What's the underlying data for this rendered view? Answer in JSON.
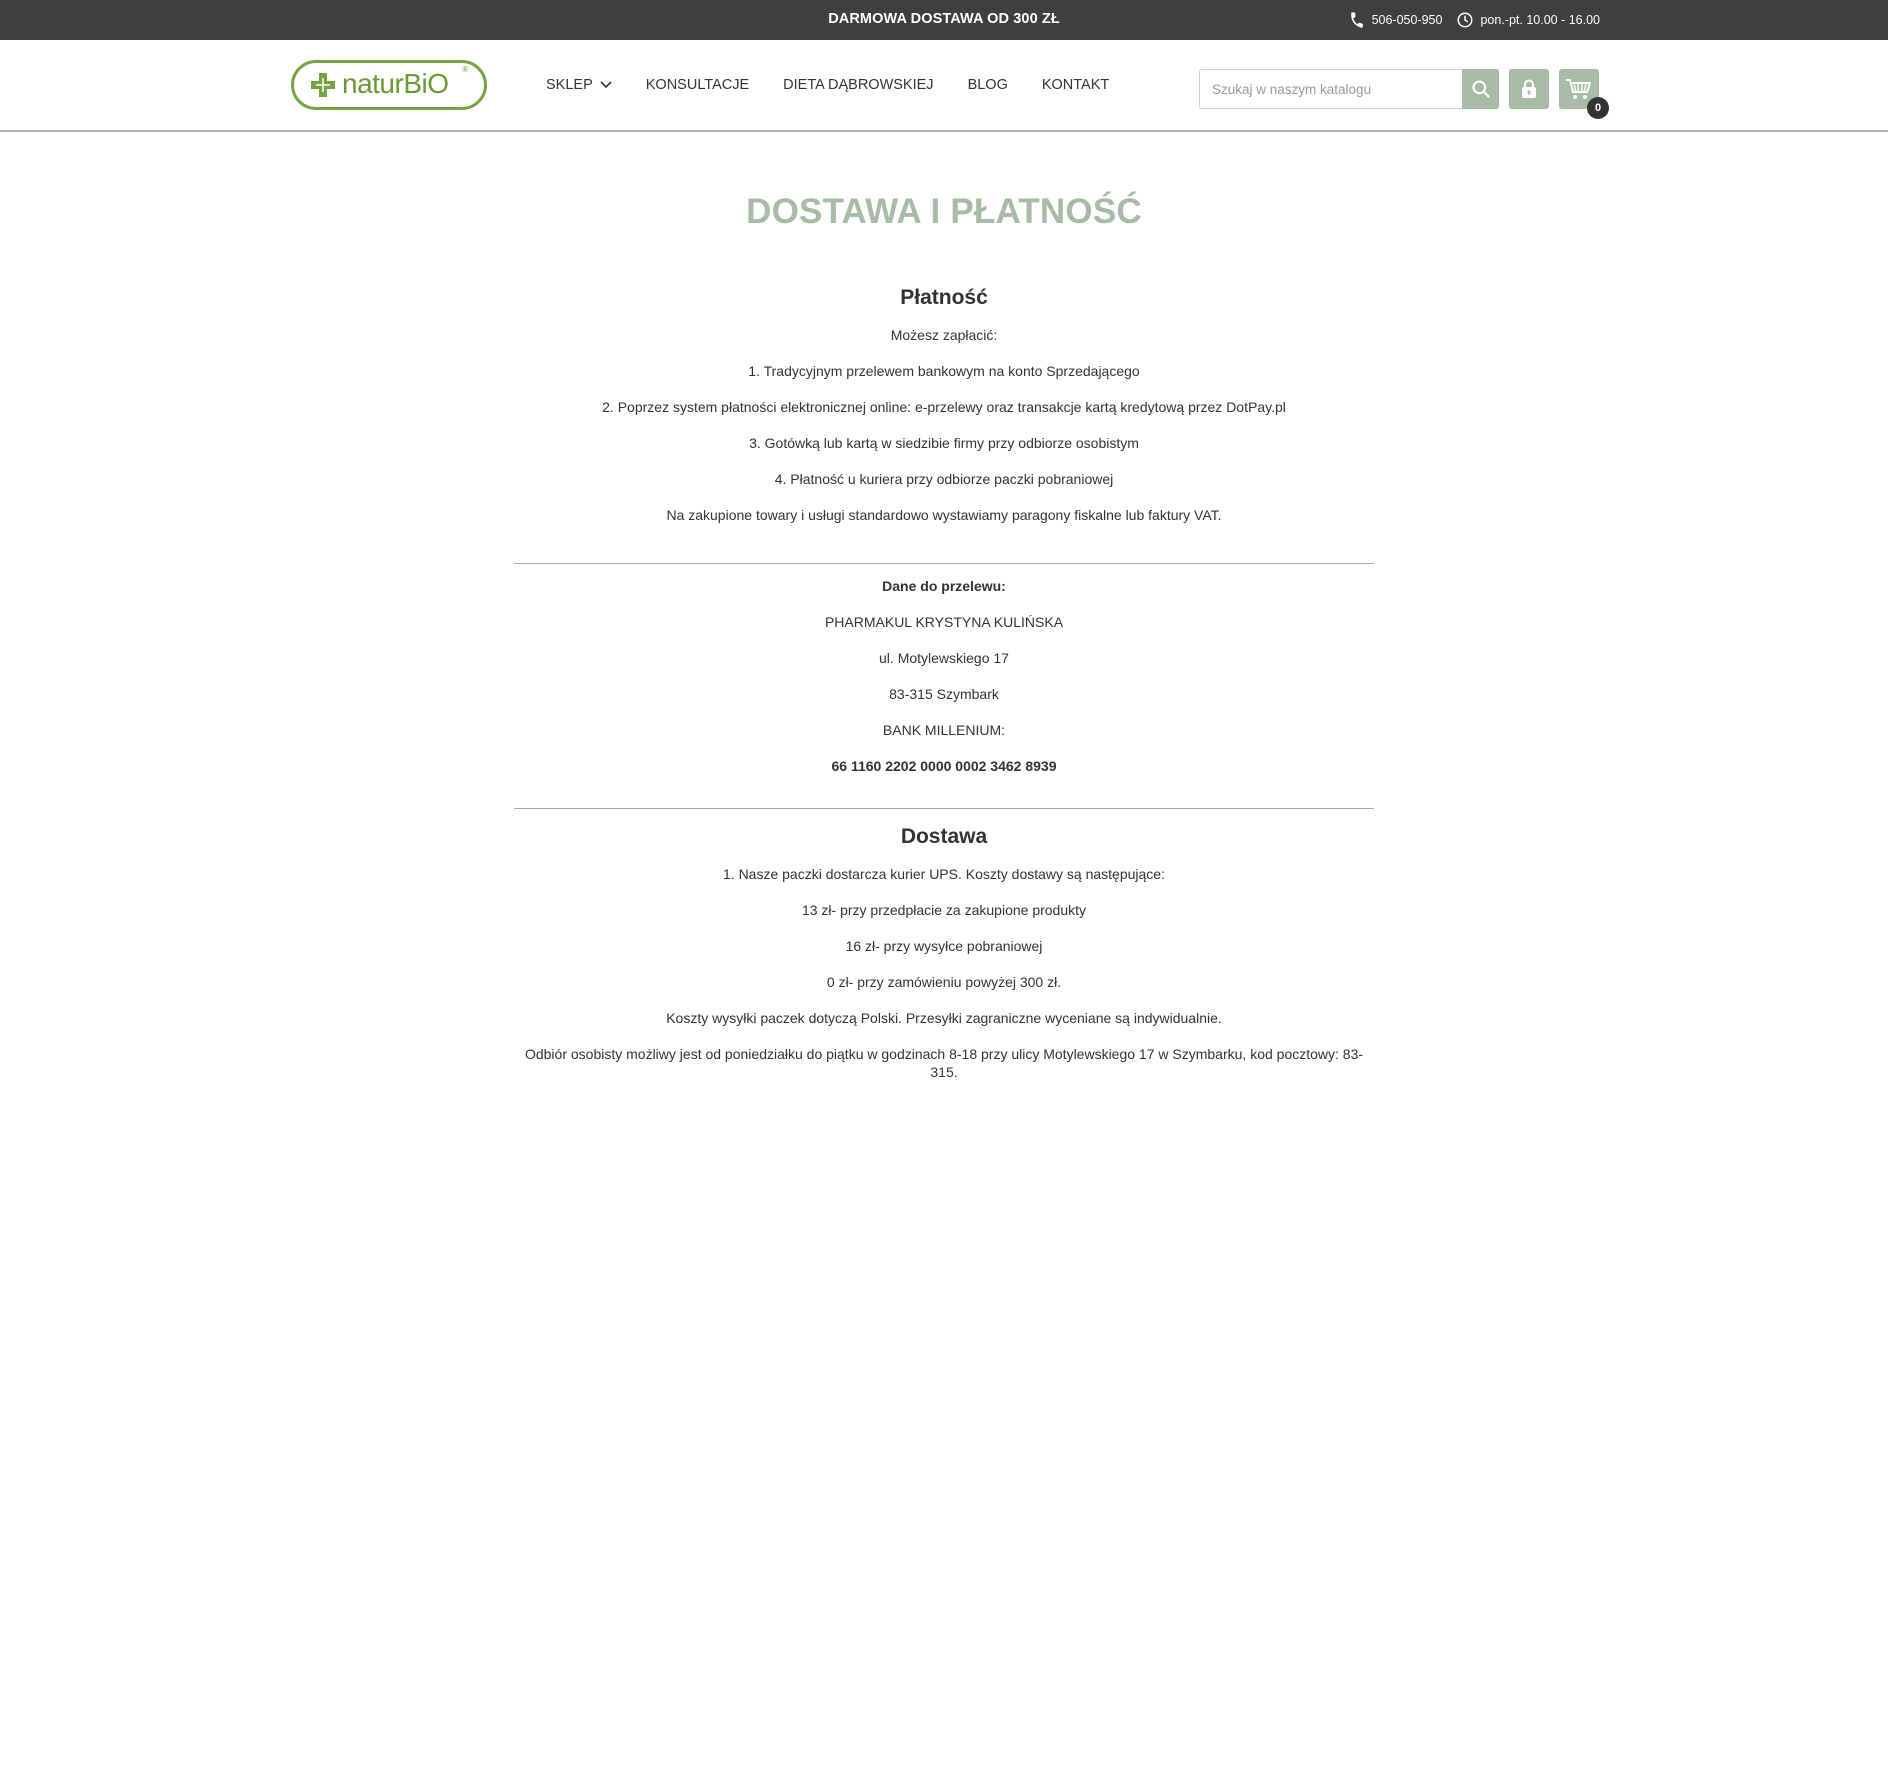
{
  "topbar": {
    "promo": "DARMOWA DOSTAWA OD 300 ZŁ",
    "phone": "506-050-950",
    "hours": "pon.-pt. 10.00 - 16.00",
    "phone_icon": "phone-icon",
    "clock_icon": "clock-icon"
  },
  "header": {
    "logo_text": "naturBiO",
    "logo_reg": "®",
    "nav": [
      {
        "label": "SKLEP",
        "has_dropdown": true
      },
      {
        "label": "KONSULTACJE"
      },
      {
        "label": "DIETA DĄBROWSKIEJ"
      },
      {
        "label": "BLOG"
      },
      {
        "label": "KONTAKT"
      }
    ],
    "search": {
      "placeholder": "Szukaj w naszym katalogu",
      "value": ""
    },
    "cart_count": "0"
  },
  "colors": {
    "accent": "#a7bba6",
    "logo_green": "#76a443",
    "topbar_bg": "#3f3f3f",
    "text": "#333333"
  },
  "page": {
    "title": "DOSTAWA I PŁATNOŚĆ",
    "payment": {
      "heading": "Płatność",
      "intro": "Możesz zapłacić:",
      "options": [
        "1. Tradycyjnym przelewem bankowym na konto Sprzedającego",
        "2. Poprzez system płatności elektronicznej online: e-przelewy oraz transakcje kartą kredytową przez DotPay.pl",
        "3. Gotówką lub kartą w siedzibie firmy przy odbiorze osobistym",
        "4. Płatność u kuriera przy odbiorze paczki pobraniowej"
      ],
      "note": "Na zakupione towary i usługi standardowo wystawiamy paragony fiskalne lub faktury VAT."
    },
    "transfer": {
      "heading": "Dane do przelewu:",
      "company": "PHARMAKUL KRYSTYNA KULIŃSKA",
      "street": "ul. Motylewskiego 17",
      "city": "83-315 Szymbark",
      "bank": "BANK MILLENIUM:",
      "account": "66 1160 2202 0000 0002 3462 8939"
    },
    "delivery": {
      "heading": "Dostawa",
      "intro": "1. Nasze paczki dostarcza kurier UPS. Koszty dostawy są następujące:",
      "costs": [
        "13 zł- przy przedpłacie za zakupione produkty",
        "16 zł- przy wysyłce pobraniowej",
        "0 zł- przy zamówieniu powyżej 300 zł."
      ],
      "note": "Koszty wysyłki paczek dotyczą Polski. Przesyłki zagraniczne wyceniane są indywidualnie.",
      "pickup": "Odbiór osobisty możliwy jest od poniedziałku do piątku w godzinach 8-18 przy ulicy Motylewskiego 17 w Szymbarku, kod pocztowy: 83-315."
    }
  }
}
